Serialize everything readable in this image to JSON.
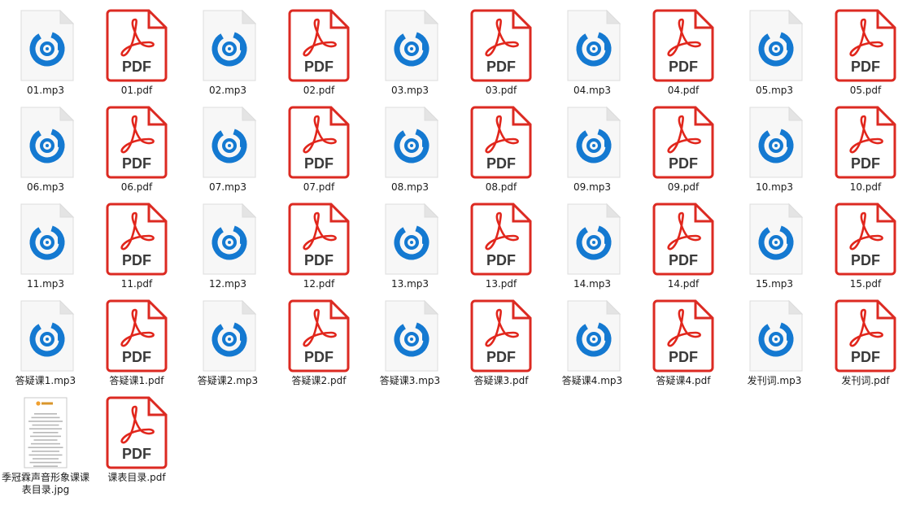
{
  "window": {
    "view": "large-icons"
  },
  "colors": {
    "pdf_red": "#e1261c",
    "pdf_border": "#dc2a22",
    "audio_blue": "#1479d1",
    "page_gray": "#dcdcdc",
    "page_fill": "#f7f7f7"
  },
  "files": [
    {
      "name": "01.mp3",
      "type": "mp3",
      "icon": "audio-file-icon"
    },
    {
      "name": "01.pdf",
      "type": "pdf",
      "icon": "pdf-file-icon"
    },
    {
      "name": "02.mp3",
      "type": "mp3",
      "icon": "audio-file-icon"
    },
    {
      "name": "02.pdf",
      "type": "pdf",
      "icon": "pdf-file-icon"
    },
    {
      "name": "03.mp3",
      "type": "mp3",
      "icon": "audio-file-icon"
    },
    {
      "name": "03.pdf",
      "type": "pdf",
      "icon": "pdf-file-icon"
    },
    {
      "name": "04.mp3",
      "type": "mp3",
      "icon": "audio-file-icon"
    },
    {
      "name": "04.pdf",
      "type": "pdf",
      "icon": "pdf-file-icon"
    },
    {
      "name": "05.mp3",
      "type": "mp3",
      "icon": "audio-file-icon"
    },
    {
      "name": "05.pdf",
      "type": "pdf",
      "icon": "pdf-file-icon"
    },
    {
      "name": "06.mp3",
      "type": "mp3",
      "icon": "audio-file-icon"
    },
    {
      "name": "06.pdf",
      "type": "pdf",
      "icon": "pdf-file-icon"
    },
    {
      "name": "07.mp3",
      "type": "mp3",
      "icon": "audio-file-icon"
    },
    {
      "name": "07.pdf",
      "type": "pdf",
      "icon": "pdf-file-icon"
    },
    {
      "name": "08.mp3",
      "type": "mp3",
      "icon": "audio-file-icon"
    },
    {
      "name": "08.pdf",
      "type": "pdf",
      "icon": "pdf-file-icon"
    },
    {
      "name": "09.mp3",
      "type": "mp3",
      "icon": "audio-file-icon"
    },
    {
      "name": "09.pdf",
      "type": "pdf",
      "icon": "pdf-file-icon"
    },
    {
      "name": "10.mp3",
      "type": "mp3",
      "icon": "audio-file-icon"
    },
    {
      "name": "10.pdf",
      "type": "pdf",
      "icon": "pdf-file-icon"
    },
    {
      "name": "11.mp3",
      "type": "mp3",
      "icon": "audio-file-icon"
    },
    {
      "name": "11.pdf",
      "type": "pdf",
      "icon": "pdf-file-icon"
    },
    {
      "name": "12.mp3",
      "type": "mp3",
      "icon": "audio-file-icon"
    },
    {
      "name": "12.pdf",
      "type": "pdf",
      "icon": "pdf-file-icon"
    },
    {
      "name": "13.mp3",
      "type": "mp3",
      "icon": "audio-file-icon"
    },
    {
      "name": "13.pdf",
      "type": "pdf",
      "icon": "pdf-file-icon"
    },
    {
      "name": "14.mp3",
      "type": "mp3",
      "icon": "audio-file-icon"
    },
    {
      "name": "14.pdf",
      "type": "pdf",
      "icon": "pdf-file-icon"
    },
    {
      "name": "15.mp3",
      "type": "mp3",
      "icon": "audio-file-icon"
    },
    {
      "name": "15.pdf",
      "type": "pdf",
      "icon": "pdf-file-icon"
    },
    {
      "name": "答疑课1.mp3",
      "type": "mp3",
      "icon": "audio-file-icon"
    },
    {
      "name": "答疑课1.pdf",
      "type": "pdf",
      "icon": "pdf-file-icon"
    },
    {
      "name": "答疑课2.mp3",
      "type": "mp3",
      "icon": "audio-file-icon"
    },
    {
      "name": "答疑课2.pdf",
      "type": "pdf",
      "icon": "pdf-file-icon"
    },
    {
      "name": "答疑课3.mp3",
      "type": "mp3",
      "icon": "audio-file-icon"
    },
    {
      "name": "答疑课3.pdf",
      "type": "pdf",
      "icon": "pdf-file-icon"
    },
    {
      "name": "答疑课4.mp3",
      "type": "mp3",
      "icon": "audio-file-icon"
    },
    {
      "name": "答疑课4.pdf",
      "type": "pdf",
      "icon": "pdf-file-icon"
    },
    {
      "name": "发刊词.mp3",
      "type": "mp3",
      "icon": "audio-file-icon"
    },
    {
      "name": "发刊词.pdf",
      "type": "pdf",
      "icon": "pdf-file-icon"
    },
    {
      "name": "季冠霖声音形象课课表目录.jpg",
      "type": "jpg",
      "icon": "image-thumbnail-icon"
    },
    {
      "name": "课表目录.pdf",
      "type": "pdf",
      "icon": "pdf-file-icon"
    }
  ]
}
